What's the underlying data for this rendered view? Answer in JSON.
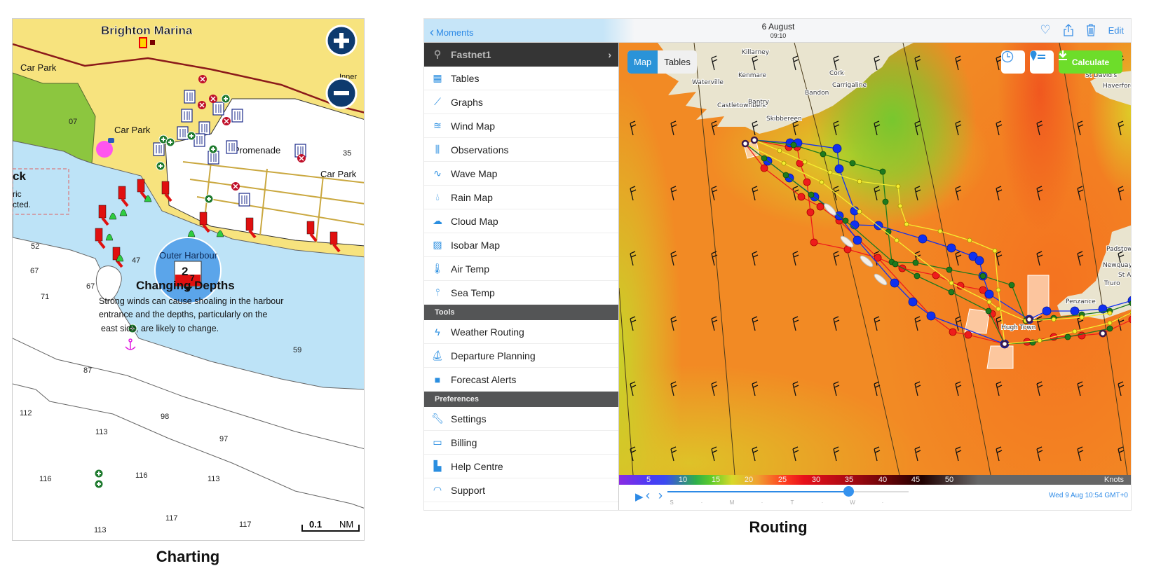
{
  "captions": {
    "charting": "Charting",
    "routing": "Routing"
  },
  "chart": {
    "title": "Brighton Marina",
    "labels": {
      "car_park_1": "Car Park",
      "car_park_2": "Car Park",
      "car_park_3": "Car Park",
      "promenade": "Promenade",
      "inner": "Inner",
      "ck": "ck",
      "ric": "ric",
      "cted": "cted.",
      "outer_harbour": "Outer Harbour"
    },
    "depths": [
      "07",
      "35",
      "52",
      "67",
      "67",
      "71",
      "47",
      "59",
      "87",
      "112",
      "98",
      "113",
      "97",
      "116",
      "116",
      "113",
      "117",
      "117",
      "113"
    ],
    "popup": {
      "title": "Changing Depths",
      "icon_depth_main": "2",
      "icon_depth_sub": "7",
      "lines": [
        "Strong winds can cause shoaling in the harbour",
        "entrance and the depths, particularly on the",
        "east side, are likely to change."
      ]
    },
    "zoom_in_icon": "plus-icon",
    "zoom_out_icon": "minus-icon",
    "scale": {
      "value": "0.1",
      "unit": "NM"
    }
  },
  "routing": {
    "nav": {
      "back_label": "Moments",
      "title": "6 August",
      "subtitle": "09:10",
      "edit_label": "Edit"
    },
    "sidebar": {
      "current": "Fastnet1",
      "items": [
        {
          "label": "Tables",
          "icon": "table-icon"
        },
        {
          "label": "Graphs",
          "icon": "graph-icon"
        },
        {
          "label": "Wind Map",
          "icon": "wind-icon"
        },
        {
          "label": "Observations",
          "icon": "observations-icon"
        },
        {
          "label": "Wave Map",
          "icon": "wave-icon"
        },
        {
          "label": "Rain Map",
          "icon": "rain-drop-icon"
        },
        {
          "label": "Cloud Map",
          "icon": "cloud-icon"
        },
        {
          "label": "Isobar Map",
          "icon": "isobar-icon"
        },
        {
          "label": "Air Temp",
          "icon": "thermometer-icon"
        },
        {
          "label": "Sea Temp",
          "icon": "sea-temp-icon"
        }
      ],
      "tools_header": "Tools",
      "tools": [
        {
          "label": "Weather Routing",
          "icon": "route-icon"
        },
        {
          "label": "Departure Planning",
          "icon": "sailboat-icon"
        },
        {
          "label": "Forecast Alerts",
          "icon": "alert-icon"
        }
      ],
      "preferences_header": "Preferences",
      "preferences": [
        {
          "label": "Settings",
          "icon": "wrench-icon"
        },
        {
          "label": "Billing",
          "icon": "billing-icon"
        },
        {
          "label": "Help Centre",
          "icon": "document-icon"
        },
        {
          "label": "Support",
          "icon": "headset-icon"
        }
      ]
    },
    "map": {
      "view_tabs": [
        "Map",
        "Tables"
      ],
      "active_tab": "Map",
      "calculate_label": "Calculate",
      "places": [
        "Killarney",
        "Kenmare",
        "Waterville",
        "Castletownbere",
        "Bantry",
        "Skibbereen",
        "Bandon",
        "Cork",
        "Carrigaline",
        "St David's",
        "Haverfordw",
        "Hugh Town",
        "Penzance",
        "Truro",
        "Newquay",
        "Padstow",
        "St A"
      ],
      "route_colors": {
        "red": "#ee1c1c",
        "blue": "#1030f0",
        "green": "#1e7a1e",
        "yellow": "#f5ee30"
      }
    },
    "legend": {
      "values": [
        "5",
        "10",
        "15",
        "20",
        "25",
        "30",
        "35",
        "40",
        "45",
        "50"
      ],
      "unit": "Knots"
    },
    "timeline": {
      "days": [
        "S",
        "·",
        "M",
        "·",
        "T",
        "·",
        "W",
        "·"
      ],
      "progress": 0.75,
      "current": "Wed 9 Aug 10:54 GMT+0"
    }
  }
}
